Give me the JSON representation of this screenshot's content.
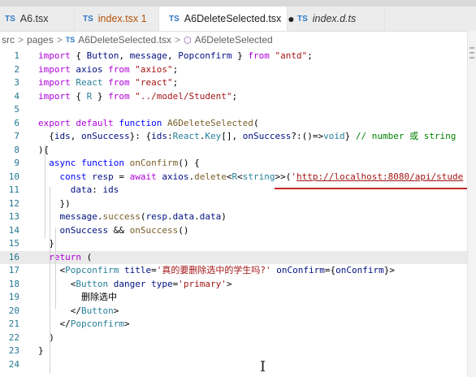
{
  "tabs": [
    {
      "label": "A6.tsx",
      "icon": "TS",
      "state": "normal"
    },
    {
      "label": "index.tsx 1",
      "icon": "TS",
      "state": "modified"
    },
    {
      "label": "A6DeleteSelected.tsx",
      "icon": "TS",
      "state": "active",
      "dirty": "●"
    },
    {
      "label": "index.d.ts",
      "icon": "TS",
      "state": "italic"
    }
  ],
  "breadcrumb": {
    "src": "src",
    "pages": "pages",
    "file_icon": "TS",
    "file": "A6DeleteSelected.tsx",
    "symbol": "A6DeleteSelected",
    "sep": ">"
  },
  "code": {
    "lines": [
      "import { Button, message, Popconfirm } from \"antd\";",
      "import axios from \"axios\";",
      "import React from \"react\";",
      "import { R } from \"../model/Student\";",
      "",
      "export default function A6DeleteSelected(",
      "  {ids, onSuccess}: {ids:React.Key[], onSuccess?:()=>void} // number 或 string",
      "){",
      "  async function onConfirm() {",
      "    const resp = await axios.delete<R<string>>('http://localhost:8080/api/stude",
      "      data: ids",
      "    })",
      "    message.success(resp.data.data)",
      "    onSuccess && onSuccess()",
      "  }",
      "  return (",
      "    <Popconfirm title='真的要删除选中的学生吗?' onConfirm={onConfirm}>",
      "      <Button danger type='primary'>",
      "        删除选中",
      "      </Button>",
      "    </Popconfirm>",
      "  )",
      "}",
      ""
    ],
    "line_numbers": [
      "1",
      "2",
      "3",
      "4",
      "5",
      "6",
      "7",
      "8",
      "9",
      "10",
      "11",
      "12",
      "13",
      "14",
      "15",
      "16",
      "17",
      "18",
      "19",
      "20",
      "21",
      "22",
      "23",
      "24"
    ]
  },
  "colors": {
    "keyword": "#0000ff",
    "control": "#af00db",
    "string": "#a31515",
    "function": "#795e26",
    "variable": "#001080",
    "type": "#267f99",
    "comment": "#008000",
    "line_number": "#237893"
  }
}
